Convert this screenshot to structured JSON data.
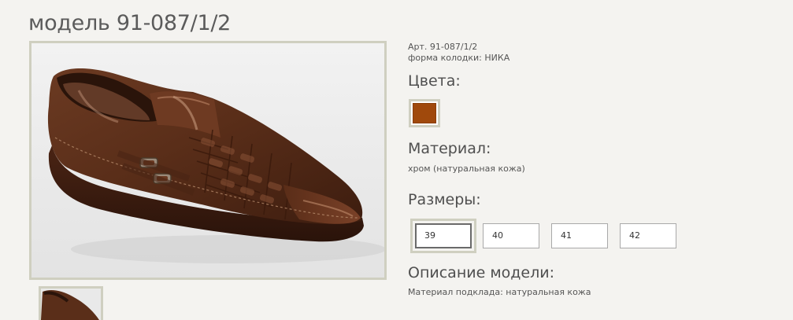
{
  "product": {
    "title": "модель 91-087/1/2",
    "article": "Арт. 91-087/1/2",
    "last_shape": "форма колодки: НИКА"
  },
  "colors": {
    "heading": "Цвета:",
    "items": [
      {
        "name": "brown",
        "hex": "#a0490c"
      }
    ]
  },
  "material": {
    "heading": "Материал:",
    "value": "хром (натуральная кожа)"
  },
  "sizes": {
    "heading": "Размеры:",
    "items": [
      "39",
      "40",
      "41",
      "42"
    ],
    "selected": "39"
  },
  "description": {
    "heading": "Описание модели:",
    "text": "Материал подклада: натуральная кожа"
  },
  "images": {
    "main": "shoe-photo",
    "thumbnails": [
      "shoe-thumbnail"
    ]
  }
}
